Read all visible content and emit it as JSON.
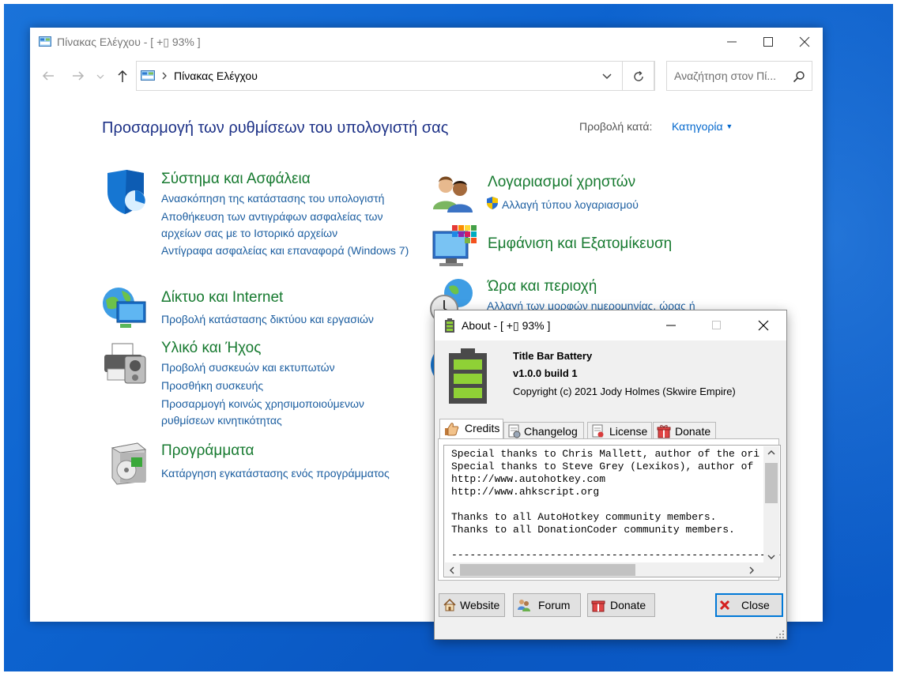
{
  "control_panel": {
    "window_title": "Πίνακας Ελέγχου - [ +▯ 93% ]",
    "address": "Πίνακας Ελέγχου",
    "search_placeholder": "Αναζήτηση στον Πί...",
    "heading": "Προσαρμογή των ρυθμίσεων του υπολογιστή σας",
    "view_by_label": "Προβολή κατά:",
    "view_by_value": "Κατηγορία",
    "categories": [
      {
        "title": "Σύστημα και Ασφάλεια",
        "icon": "shield-icon",
        "links": [
          "Ανασκόπηση της κατάστασης του υπολογιστή",
          "Αποθήκευση των αντιγράφων ασφαλείας των αρχείων σας με το Ιστορικό αρχείων",
          "Αντίγραφα ασφαλείας και επαναφορά (Windows 7)"
        ]
      },
      {
        "title": "Δίκτυο και Internet",
        "icon": "network-icon",
        "links": [
          "Προβολή κατάστασης δικτύου και εργασιών"
        ]
      },
      {
        "title": "Υλικό και Ήχος",
        "icon": "printer-icon",
        "links": [
          "Προβολή συσκευών και εκτυπωτών",
          "Προσθήκη συσκευής",
          "Προσαρμογή κοινώς χρησιμοποιούμενων ρυθμίσεων κινητικότητας"
        ]
      },
      {
        "title": "Προγράμματα",
        "icon": "programs-icon",
        "links": [
          "Κατάργηση εγκατάστασης ενός προγράμματος"
        ]
      },
      {
        "title": "Λογαριασμοί χρηστών",
        "icon": "users-icon",
        "links": [
          "Αλλαγή τύπου λογαριασμού"
        ]
      },
      {
        "title": "Εμφάνιση και Εξατομίκευση",
        "icon": "display-icon",
        "links": []
      },
      {
        "title": "Ώρα και περιοχή",
        "icon": "clock-globe-icon",
        "links": [
          "Αλλαγή των μορφών ημερομηνίας, ώρας ή"
        ]
      }
    ]
  },
  "about": {
    "window_title": "About - [ +▯ 93% ]",
    "app_name": "Title Bar Battery",
    "version": "v1.0.0 build 1",
    "copyright": "Copyright (c) 2021 Jody Holmes (Skwire Empire)",
    "tabs": [
      "Credits",
      "Changelog",
      "License",
      "Donate"
    ],
    "active_tab": "Credits",
    "credits_lines": [
      "Special thanks to Chris Mallett, author of the ori",
      "Special thanks to Steve Grey (Lexikos), author of",
      "http://www.autohotkey.com",
      "http://www.ahkscript.org",
      "",
      "Thanks to all AutoHotkey community members.",
      "Thanks to all DonationCoder community members.",
      "",
      "-------------------------------------------------------"
    ],
    "buttons": {
      "website": "Website",
      "forum": "Forum",
      "donate": "Donate",
      "close": "Close"
    },
    "battery_color": "#8fd136"
  }
}
